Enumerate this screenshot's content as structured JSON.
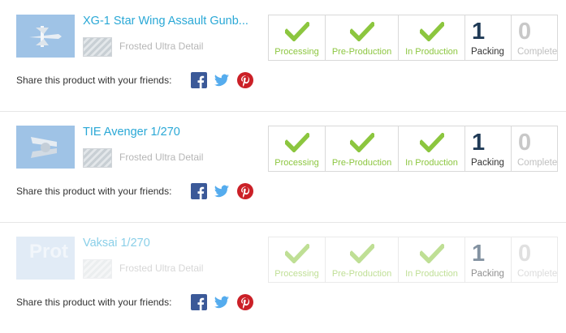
{
  "products": [
    {
      "title": "XG-1 Star Wing Assault Gunb...",
      "material": "Frosted Ultra Detail",
      "share_label": "Share this product with your friends:",
      "stages": [
        "Processing",
        "Pre-Production",
        "In Production"
      ],
      "packing": {
        "count": "1",
        "label": "Packing"
      },
      "complete": {
        "count": "0",
        "label": "Complete"
      }
    },
    {
      "title": "TIE Avenger 1/270",
      "material": "Frosted Ultra Detail",
      "share_label": "Share this product with your friends:",
      "stages": [
        "Processing",
        "Pre-Production",
        "In Production"
      ],
      "packing": {
        "count": "1",
        "label": "Packing"
      },
      "complete": {
        "count": "0",
        "label": "Complete"
      }
    },
    {
      "title": "Vaksai 1/270",
      "thumb_text": "Prot",
      "material": "Frosted Ultra Detail",
      "share_label": "Share this product with your friends:",
      "stages": [
        "Processing",
        "Pre-Production",
        "In Production"
      ],
      "packing": {
        "count": "1",
        "label": "Packing"
      },
      "complete": {
        "count": "0",
        "label": "Complete"
      }
    }
  ],
  "colors": {
    "title": "#2aa8d6",
    "check": "#8cc63f",
    "facebook": "#3b5998",
    "twitter": "#55acee",
    "pinterest": "#cb2027",
    "count": "#1f3a56"
  },
  "icons": [
    "product-thumbnail",
    "material-swatch",
    "facebook-icon",
    "twitter-icon",
    "pinterest-icon",
    "checkmark-icon"
  ]
}
